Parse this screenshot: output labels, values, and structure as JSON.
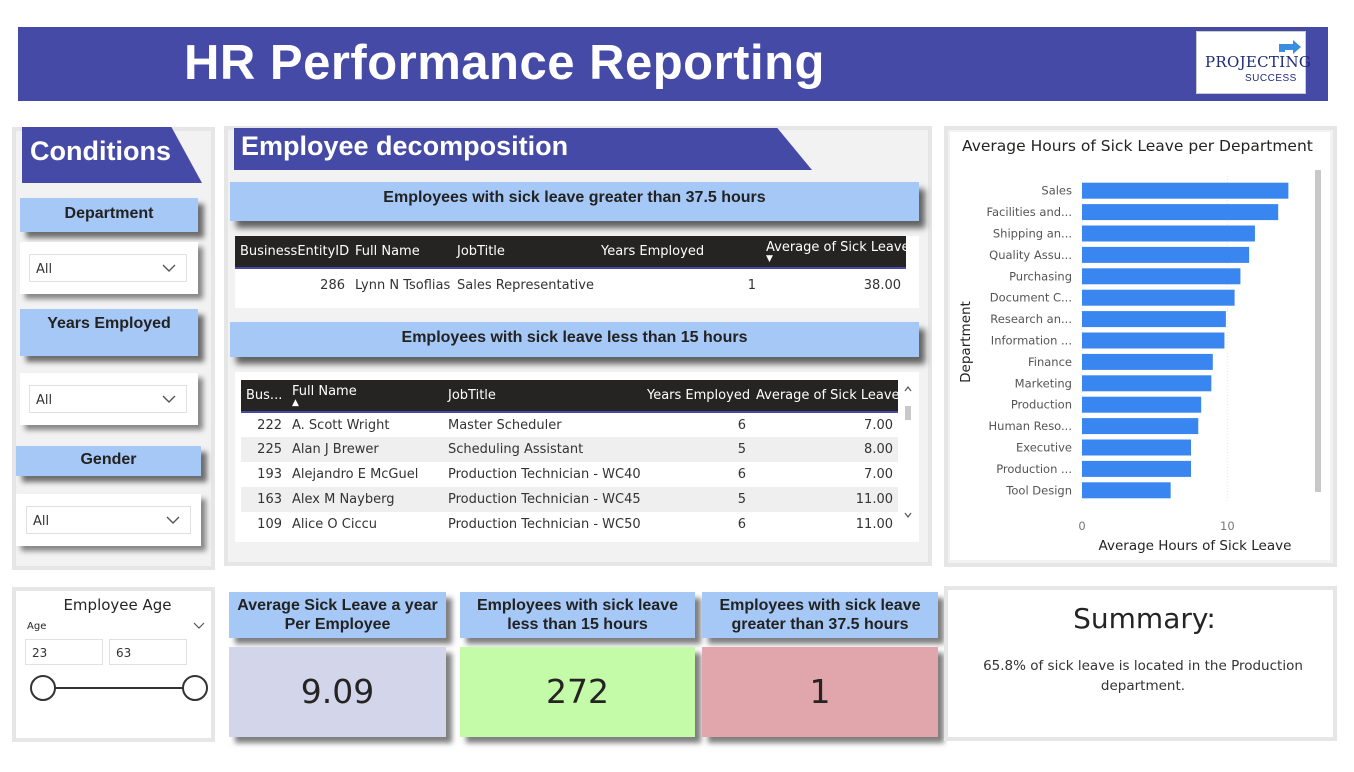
{
  "header": {
    "title": "HR Performance Reporting",
    "logo_main": "PROJECTING",
    "logo_sub": "SUCCESS"
  },
  "conditions": {
    "title": "Conditions",
    "department": {
      "label": "Department",
      "value": "All"
    },
    "years_employed": {
      "label": "Years Employed",
      "value": "All"
    },
    "gender": {
      "label": "Gender",
      "value": "All"
    }
  },
  "decomposition": {
    "title": "Employee decomposition",
    "high_table": {
      "title": "Employees with sick leave greater than 37.5 hours",
      "columns": [
        "BusinessEntityID",
        "Full Name",
        "JobTitle",
        "Years Employed",
        "Average of Sick Leave"
      ],
      "rows": [
        [
          "286",
          "Lynn N Tsoflias",
          "Sales Representative",
          "1",
          "38.00"
        ]
      ]
    },
    "low_table": {
      "title": "Employees with sick leave less than 15 hours",
      "columns": [
        "Bus...",
        "Full Name",
        "JobTitle",
        "Years Employed",
        "Average of Sick Leave"
      ],
      "rows": [
        [
          "222",
          "A. Scott Wright",
          "Master Scheduler",
          "6",
          "7.00"
        ],
        [
          "225",
          "Alan J Brewer",
          "Scheduling Assistant",
          "5",
          "8.00"
        ],
        [
          "193",
          "Alejandro E McGuel",
          "Production Technician - WC40",
          "6",
          "7.00"
        ],
        [
          "163",
          "Alex M Nayberg",
          "Production Technician - WC45",
          "5",
          "11.00"
        ],
        [
          "109",
          "Alice O Ciccu",
          "Production Technician - WC50",
          "6",
          "11.00"
        ]
      ]
    }
  },
  "chart_data": {
    "type": "bar",
    "orientation": "horizontal",
    "title": "Average Hours of Sick Leave per Department",
    "xlabel": "Average Hours of Sick Leave",
    "ylabel": "Department",
    "categories": [
      "Sales",
      "Facilities and...",
      "Shipping an...",
      "Quality Assu...",
      "Purchasing",
      "Document C...",
      "Research an...",
      "Information ...",
      "Finance",
      "Marketing",
      "Production",
      "Human Reso...",
      "Executive",
      "Production ...",
      "Tool Design"
    ],
    "values": [
      14.2,
      13.5,
      11.9,
      11.5,
      10.9,
      10.5,
      9.9,
      9.8,
      9.0,
      8.9,
      8.2,
      8.0,
      7.5,
      7.5,
      6.1
    ],
    "xlim": [
      0,
      15
    ],
    "xticks": [
      "0",
      "10"
    ],
    "grid": true,
    "color": "#3a86f0"
  },
  "age_slicer": {
    "title": "Employee Age",
    "label": "Age",
    "min": "23",
    "max": "63"
  },
  "kpis": [
    {
      "label": "Average Sick Leave a year Per Employee",
      "value": "9.09",
      "color": "#d3d5ea"
    },
    {
      "label": "Employees with sick leave less than 15 hours",
      "value": "272",
      "color": "#c3fba8"
    },
    {
      "label": "Employees with sick leave greater than 37.5 hours",
      "value": "1",
      "color": "#e1a5ac"
    }
  ],
  "summary": {
    "title": "Summary:",
    "text": "65.8% of sick leave is located in the Production department."
  }
}
